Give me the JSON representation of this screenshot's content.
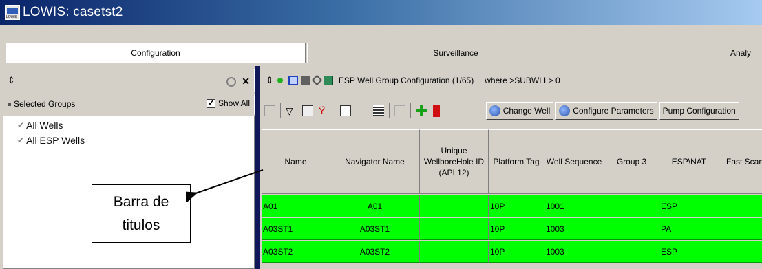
{
  "window": {
    "title": "LOWIS: casetst2"
  },
  "tabs": [
    {
      "label": "Configuration"
    },
    {
      "label": "Surveillance"
    },
    {
      "label": "Analy"
    }
  ],
  "left_panel": {
    "groups_label": "Selected Groups",
    "show_all_label": "Show All",
    "show_all_checked": true,
    "items": [
      {
        "label": "All Wells"
      },
      {
        "label": "All ESP Wells"
      }
    ]
  },
  "right_panel": {
    "title": "ESP Well Group Configuration (1/65)",
    "filter": "where >SUBWLI > 0",
    "buttons": {
      "change_well": "Change Well",
      "configure_parameters": "Configure Parameters",
      "pump_configuration": "Pump Configuration"
    }
  },
  "table": {
    "columns": [
      {
        "label": "Name"
      },
      {
        "label": "Navigator Name"
      },
      {
        "label": "Unique WellboreHole ID (API 12)"
      },
      {
        "label": "Platform Tag"
      },
      {
        "label": "Well Sequence"
      },
      {
        "label": "Group 3"
      },
      {
        "label": "ESP\\NAT"
      },
      {
        "label": "Fast Scan"
      }
    ],
    "rows": [
      {
        "name": "A01",
        "navigator": "A01",
        "unique_id": "",
        "platform": "10P",
        "sequence": "1001",
        "group3": "",
        "esp_nat": "ESP",
        "fast": ""
      },
      {
        "name": "A03ST1",
        "navigator": "A03ST1",
        "unique_id": "",
        "platform": "10P",
        "sequence": "1003",
        "group3": "",
        "esp_nat": "PA",
        "fast": ""
      },
      {
        "name": "A03ST2",
        "navigator": "A03ST2",
        "unique_id": "",
        "platform": "10P",
        "sequence": "1003",
        "group3": "",
        "esp_nat": "ESP",
        "fast": ""
      }
    ]
  },
  "annotation": {
    "line1": "Barra de",
    "line2": "titulos"
  },
  "colors": {
    "row_highlight": "#00ff00",
    "splitter": "#10185a"
  }
}
